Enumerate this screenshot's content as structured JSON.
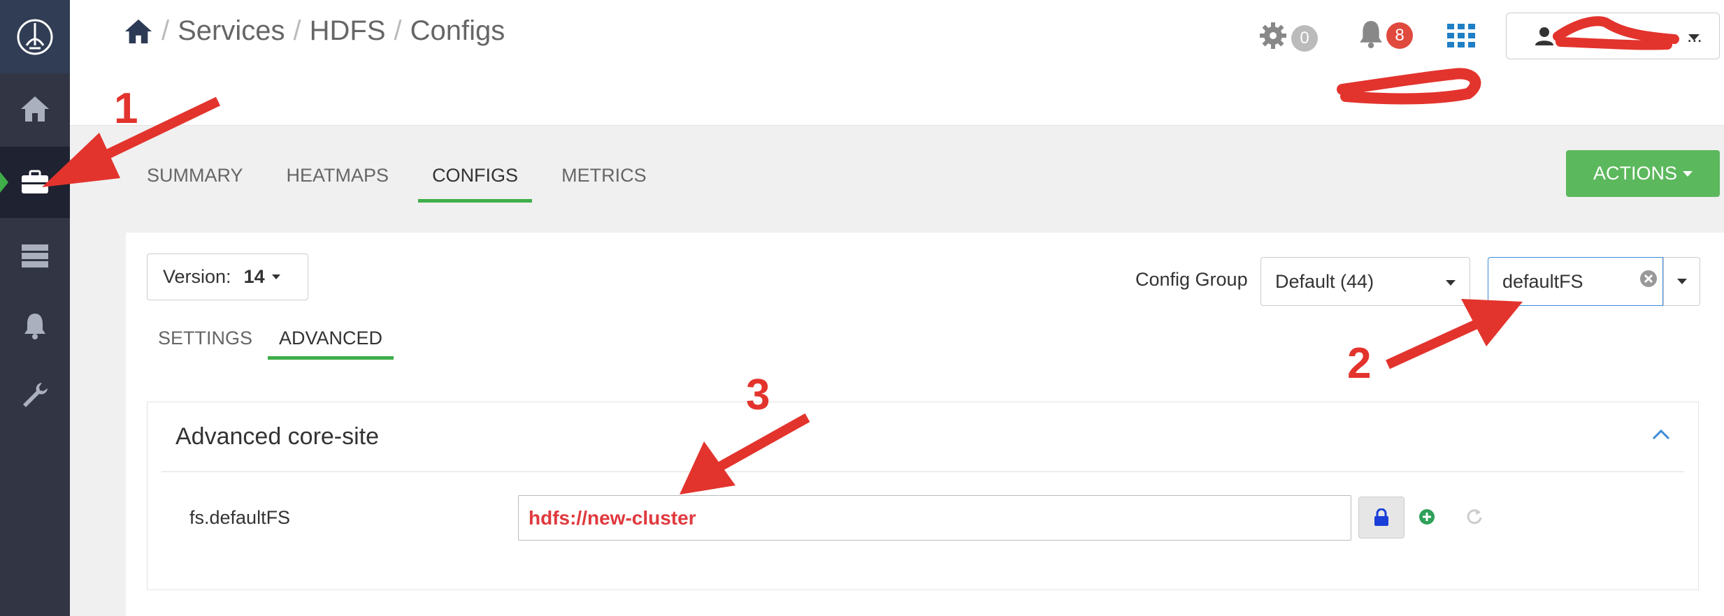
{
  "breadcrumb": {
    "separator": "/",
    "items": [
      "Services",
      "HDFS",
      "Configs"
    ]
  },
  "header": {
    "ops_count": "0",
    "alerts_count": "8",
    "user_name": "..."
  },
  "service_tabs": [
    "SUMMARY",
    "HEATMAPS",
    "CONFIGS",
    "METRICS"
  ],
  "active_service_tab": "CONFIGS",
  "actions_label": "ACTIONS",
  "version": {
    "label": "Version:",
    "value": "14"
  },
  "config_group": {
    "label": "Config Group",
    "value": "Default (44)"
  },
  "filter": {
    "value": "defaultFS"
  },
  "sub_tabs": [
    "SETTINGS",
    "ADVANCED"
  ],
  "active_sub_tab": "ADVANCED",
  "section": {
    "title": "Advanced core-site",
    "property_name": "fs.defaultFS",
    "property_value": "hdfs://new-cluster"
  },
  "annotations": [
    "1",
    "2",
    "3"
  ],
  "colors": {
    "sidebar": "#323544",
    "accent_green": "#3fae49",
    "annotation_red": "#e3332d",
    "badge_red": "#e0493e"
  }
}
